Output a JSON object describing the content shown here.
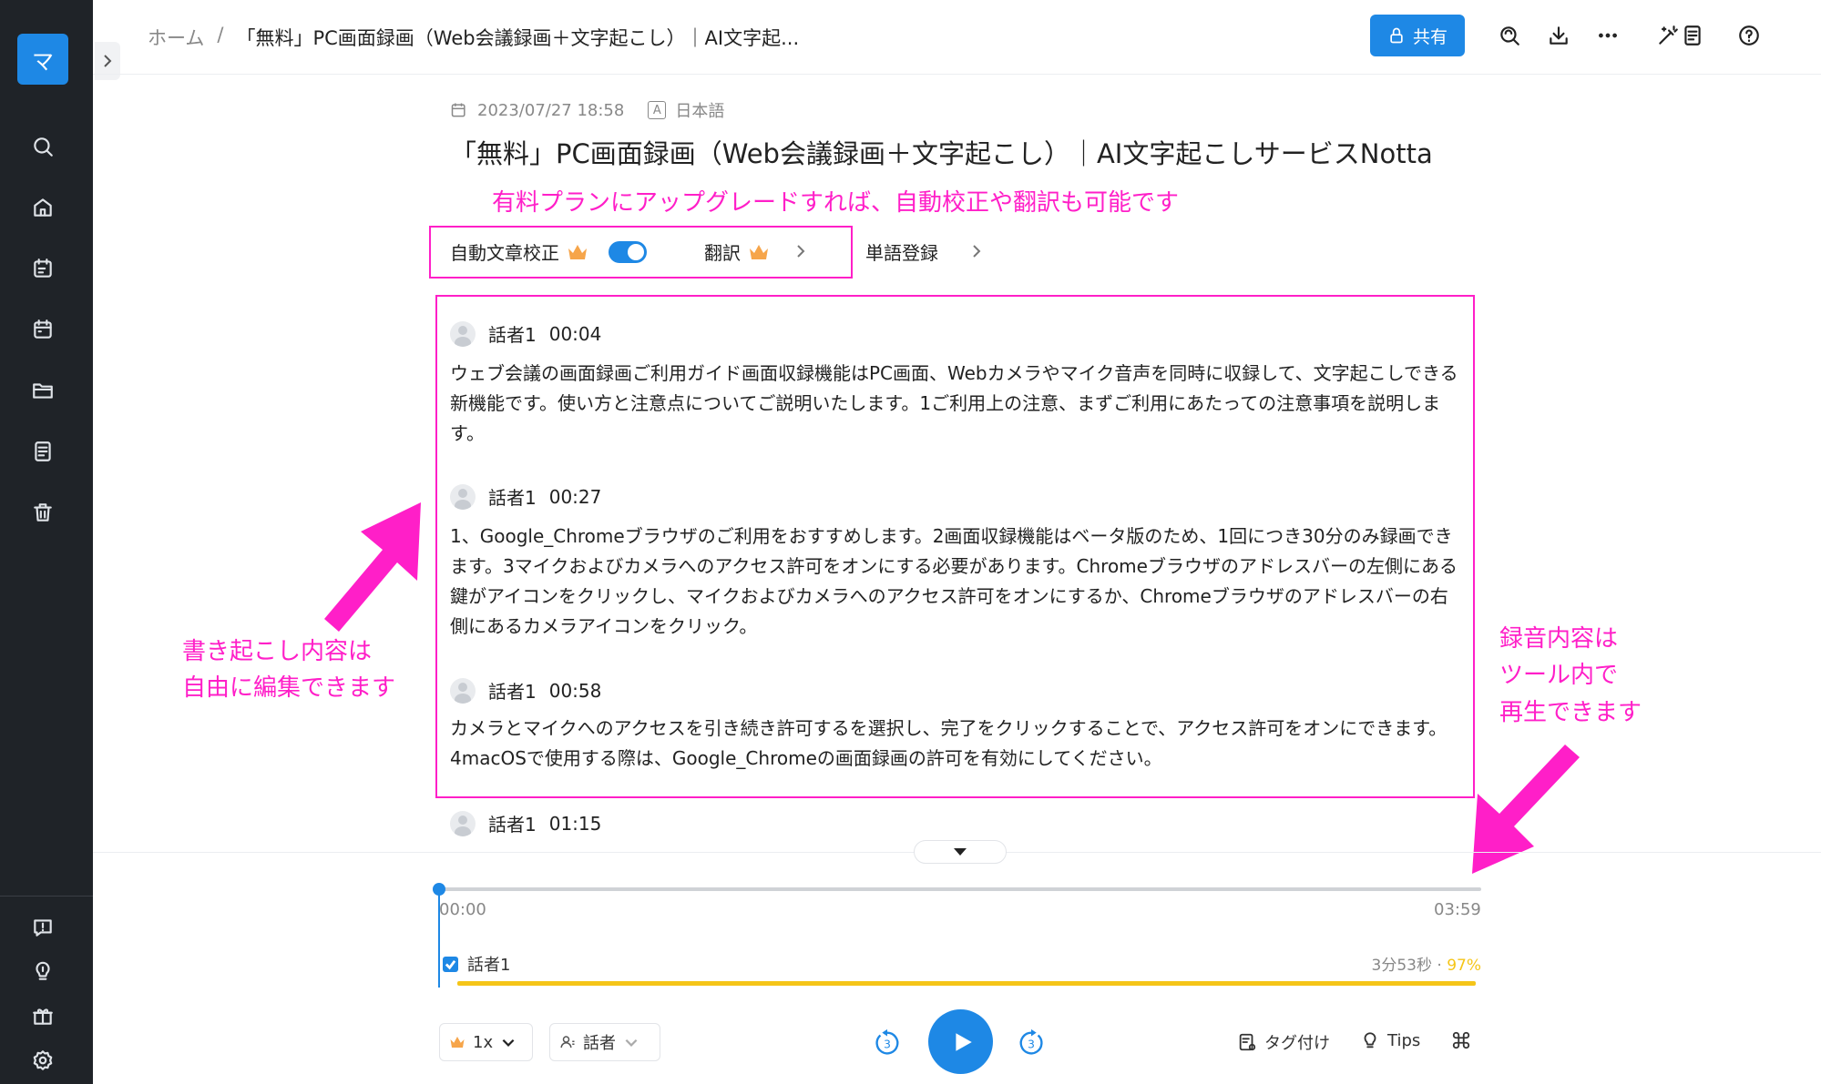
{
  "sidebar": {
    "logo_glyph": "マ",
    "icons": [
      "search-icon",
      "home-icon",
      "calendar-edit-icon",
      "calendar-icon",
      "folder-icon",
      "document-icon",
      "trash-icon",
      "feedback-icon",
      "lightbulb-icon",
      "gift-icon",
      "settings-icon"
    ]
  },
  "header": {
    "breadcrumb_home": "ホーム",
    "breadcrumb_sep": "/",
    "breadcrumb_current": "「無料」PC画面録画（Web会議録画＋文字起こし）｜AI文字起...",
    "share_label": "共有"
  },
  "meta": {
    "datetime": "2023/07/27 18:58",
    "lang_badge": "A",
    "language": "日本語"
  },
  "title": "「無料」PC画面録画（Web会議録画＋文字起こし）｜AI文字起こしサービスNotta",
  "annotations": {
    "upgrade": "有料プランにアップグレードすれば、自動校正や翻訳も可能です",
    "edit_line1": "書き起こし内容は",
    "edit_line2": "自由に編集できます",
    "play_line1": "録音内容は",
    "play_line2": "ツール内で",
    "play_line3": "再生できます"
  },
  "options": {
    "auto_correct": "自動文章校正",
    "translate": "翻訳",
    "dictionary": "単語登録"
  },
  "transcript": [
    {
      "speaker": "話者1",
      "time": "00:04",
      "text": "ウェブ会議の画面録画ご利用ガイド画面収録機能はPC画面、Webカメラやマイク音声を同時に収録して、文字起こしできる新機能です。使い方と注意点についてご説明いたします。1ご利用上の注意、まずご利用にあたっての注意事項を説明します。"
    },
    {
      "speaker": "話者1",
      "time": "00:27",
      "text": "1、Google_Chromeブラウザのご利用をおすすめします。2画面収録機能はベータ版のため、1回につき30分のみ録画できます。3マイクおよびカメラへのアクセス許可をオンにする必要があります。Chromeブラウザのアドレスバーの左側にある鍵がアイコンをクリックし、マイクおよびカメラへのアクセス許可をオンにするか、Chromeブラウザのアドレスバーの右側にあるカメラアイコンをクリック。"
    },
    {
      "speaker": "話者1",
      "time": "00:58",
      "text": "カメラとマイクへのアクセスを引き続き許可するを選択し、完了をクリックすることで、アクセス許可をオンにできます。4macOSで使用する際は、Google_Chromeの画面録画の許可を有効にしてください。"
    },
    {
      "speaker": "話者1",
      "time": "01:15",
      "text": ""
    }
  ],
  "player": {
    "time_start": "00:00",
    "time_end": "03:59",
    "progress": 0,
    "speaker_name": "話者1",
    "speaker_duration": "3分53秒",
    "speaker_sep": "·",
    "speaker_percent": "97%",
    "speed": "1x",
    "speaker_filter": "話者",
    "skip_back": "3",
    "skip_forward": "3",
    "tag_label": "タグ付け",
    "tips_label": "Tips"
  },
  "colors": {
    "accent": "#1e88e5",
    "annotation": "#ff1fc8",
    "speaker_bar": "#f5c518",
    "sidebar_bg": "#1f2328"
  }
}
